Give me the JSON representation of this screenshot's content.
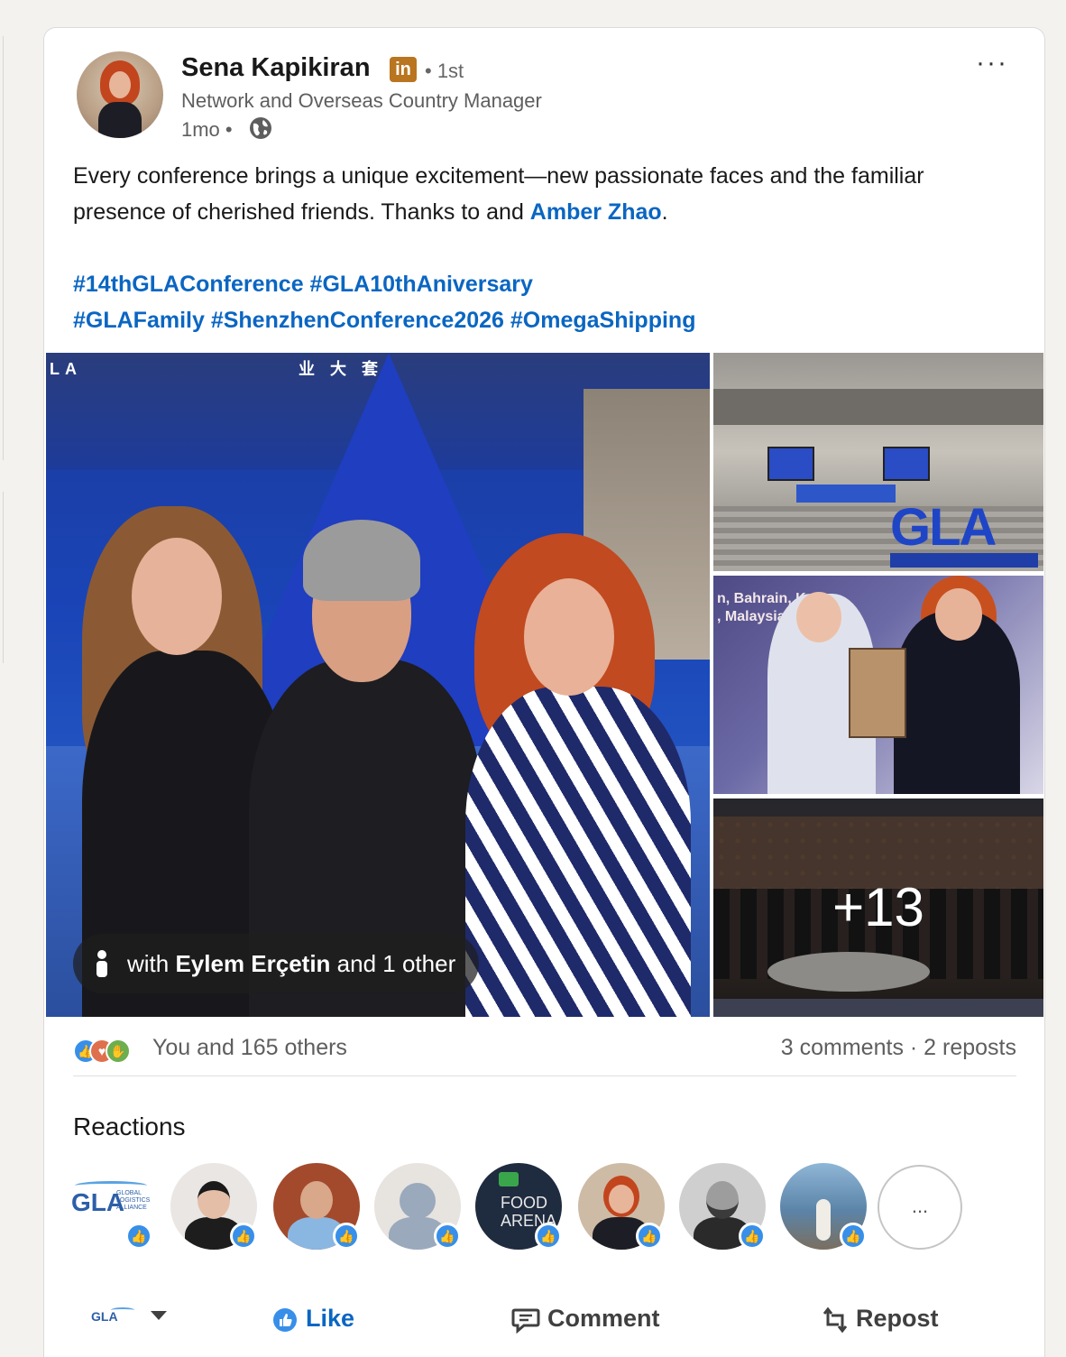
{
  "post": {
    "author": {
      "name": "Sena Kapikiran",
      "badge": "in",
      "degree": "• 1st",
      "headline": "Network and Overseas Country Manager",
      "time": "1mo •"
    },
    "text_before": "Every conference brings a unique excitement—new passionate faces and the familiar presence of cherished friends. Thanks to  and ",
    "mention": "Amber Zhao",
    "text_after": ".",
    "hashtags_line1": "#14thGLAConference #GLA10thAniversary",
    "hashtags_line2": "#GLAFamily #ShenzhenConference2026 #OmegaShipping",
    "more_label": "···"
  },
  "media": {
    "tag_prefix": "with ",
    "tag_name": "Eylem Erçetin",
    "tag_suffix": " and 1 other",
    "more_count": "+13",
    "sign_gla": "LA",
    "sign_cn": "业 大 套",
    "side_gla": "GLA"
  },
  "social": {
    "reactions_count": "You and 165 others",
    "comments_reposts": "3 comments · 2 reposts"
  },
  "reactions": {
    "title": "Reactions",
    "more_label": "...",
    "gla_logo_text": "GLA",
    "gla_logo_sub": "GLOBAL LOGISTICS ALLIANCE",
    "food_arena": "FOOD ARENA"
  },
  "actions": {
    "actor_logo": "GLA",
    "like": "Like",
    "comment": "Comment",
    "repost": "Repost"
  },
  "colors": {
    "accent": "#0a66c2",
    "like_blue": "#378fe9",
    "linkedin_premium_badge": "#b9751f"
  }
}
